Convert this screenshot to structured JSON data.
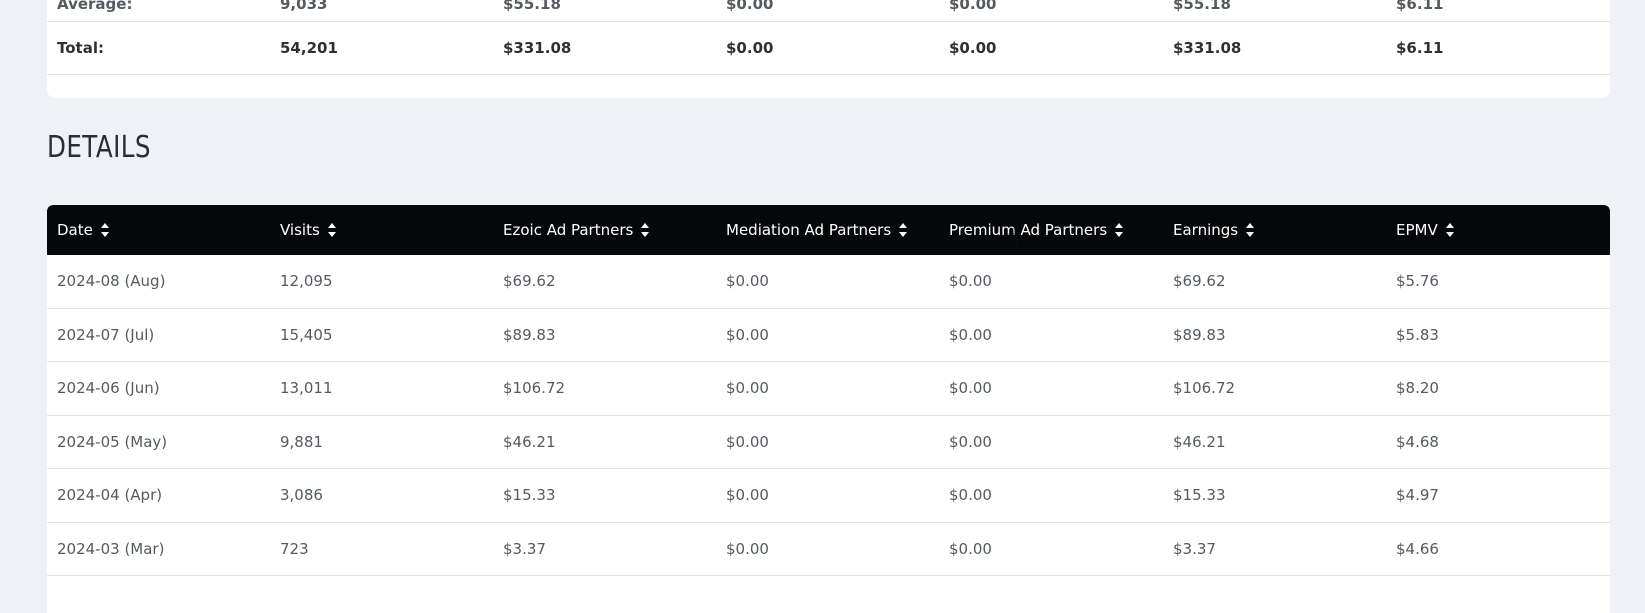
{
  "summary": {
    "average_row": [
      "Average:",
      "9,033",
      "$55.18",
      "$0.00",
      "$0.00",
      "$55.18",
      "$6.11"
    ],
    "total_row": [
      "Total:",
      "54,201",
      "$331.08",
      "$0.00",
      "$0.00",
      "$331.08",
      "$6.11"
    ]
  },
  "details": {
    "title": "DETAILS",
    "columns": [
      "Date",
      "Visits",
      "Ezoic Ad Partners",
      "Mediation Ad Partners",
      "Premium Ad Partners",
      "Earnings",
      "EPMV"
    ],
    "rows": [
      [
        "2024-08 (Aug)",
        "12,095",
        "$69.62",
        "$0.00",
        "$0.00",
        "$69.62",
        "$5.76"
      ],
      [
        "2024-07 (Jul)",
        "15,405",
        "$89.83",
        "$0.00",
        "$0.00",
        "$89.83",
        "$5.83"
      ],
      [
        "2024-06 (Jun)",
        "13,011",
        "$106.72",
        "$0.00",
        "$0.00",
        "$106.72",
        "$8.20"
      ],
      [
        "2024-05 (May)",
        "9,881",
        "$46.21",
        "$0.00",
        "$0.00",
        "$46.21",
        "$4.68"
      ],
      [
        "2024-04 (Apr)",
        "3,086",
        "$15.33",
        "$0.00",
        "$0.00",
        "$15.33",
        "$4.97"
      ],
      [
        "2024-03 (Mar)",
        "723",
        "$3.37",
        "$0.00",
        "$0.00",
        "$3.37",
        "$4.66"
      ]
    ]
  },
  "colors": {
    "page_bg": "#f0f1f6",
    "header_bg": "#060709",
    "card_bg": "#ffffff"
  },
  "icons": {
    "sort": "sort-icon",
    "cursor": "hand-pointer-cursor"
  }
}
